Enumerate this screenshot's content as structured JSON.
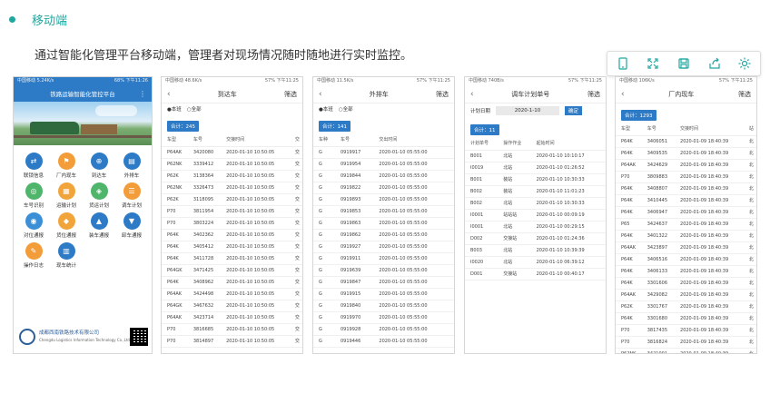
{
  "heading": "移动端",
  "intro": "通过智能化管理平台移动端，管理者对现场情况随时随地进行实时监控。",
  "accent": "#1fa7a0",
  "brand": "#2d7bc6",
  "toolbar": [
    "tablet-icon",
    "fullscreen-icon",
    "save-icon",
    "share-icon",
    "settings-icon"
  ],
  "phone1": {
    "status_left": "中国移动 5.24K/s",
    "status_right": "68% 下午11:26",
    "title": "铁路运输智能化管控平台",
    "menu": [
      {
        "label": "联锁信息",
        "color": "#2d7bc6",
        "glyph": "⇄"
      },
      {
        "label": "厂内现车",
        "color": "#f39c3a",
        "glyph": "⚑"
      },
      {
        "label": "到达车",
        "color": "#2d7bc6",
        "glyph": "⊕"
      },
      {
        "label": "外排车",
        "color": "#2d7bc6",
        "glyph": "▤"
      },
      {
        "label": "车号识别",
        "color": "#4fb56b",
        "glyph": "◎"
      },
      {
        "label": "运输计划",
        "color": "#f0a43a",
        "glyph": "▦"
      },
      {
        "label": "货运计划",
        "color": "#4fb56b",
        "glyph": "◈"
      },
      {
        "label": "调车计划",
        "color": "#f39c3a",
        "glyph": "☰"
      },
      {
        "label": "对位通报",
        "color": "#3b8fd6",
        "glyph": "◉"
      },
      {
        "label": "货位通报",
        "color": "#f0a43a",
        "glyph": "◆"
      },
      {
        "label": "装车通报",
        "color": "#2d7bc6",
        "glyph": "▲"
      },
      {
        "label": "卸车通报",
        "color": "#2d7bc6",
        "glyph": "▼"
      },
      {
        "label": "操作日志",
        "color": "#f39c3a",
        "glyph": "✎"
      },
      {
        "label": "现车统计",
        "color": "#2d7bc6",
        "glyph": "▥"
      }
    ],
    "company": "成都西南铁路技术有限公司",
    "company_en": "Chengdu Logistics Information Technology Co.,Ltd"
  },
  "arrivals": {
    "status_left": "中国移动 48.6K/s",
    "status_right": "57% 下午11:25",
    "title": "到达车",
    "action": "筛选",
    "filter": [
      "●本班",
      "○全部"
    ],
    "count": "合计：245",
    "headers": [
      "车型",
      "车号",
      "交接时间",
      "交"
    ],
    "rows": [
      [
        "P64AK",
        "3420080",
        "2020-01-10 10:50:05",
        "交"
      ],
      [
        "P62NK",
        "3339412",
        "2020-01-10 10:50:05",
        "交"
      ],
      [
        "P62K",
        "3138364",
        "2020-01-10 10:50:05",
        "交"
      ],
      [
        "P62NK",
        "3326473",
        "2020-01-10 10:50:05",
        "交"
      ],
      [
        "P62K",
        "3118095",
        "2020-01-10 10:50:05",
        "交"
      ],
      [
        "P70",
        "3811954",
        "2020-01-10 10:50:05",
        "交"
      ],
      [
        "P70",
        "3803224",
        "2020-01-10 10:50:05",
        "交"
      ],
      [
        "P64K",
        "3402362",
        "2020-01-10 10:50:05",
        "交"
      ],
      [
        "P64K",
        "3405412",
        "2020-01-10 10:50:05",
        "交"
      ],
      [
        "P64K",
        "3411728",
        "2020-01-10 10:50:05",
        "交"
      ],
      [
        "P64GK",
        "3471425",
        "2020-01-10 10:50:05",
        "交"
      ],
      [
        "P64K",
        "3408962",
        "2020-01-10 10:50:05",
        "交"
      ],
      [
        "P64AK",
        "3424498",
        "2020-01-10 10:50:05",
        "交"
      ],
      [
        "P64GK",
        "3467632",
        "2020-01-10 10:50:05",
        "交"
      ],
      [
        "P64AK",
        "3423714",
        "2020-01-10 10:50:05",
        "交"
      ],
      [
        "P70",
        "3816685",
        "2020-01-10 10:50:05",
        "交"
      ],
      [
        "P70",
        "3814897",
        "2020-01-10 10:50:05",
        "交"
      ]
    ]
  },
  "outbound": {
    "status_left": "中国移动 11.5K/s",
    "status_right": "57% 下午11:25",
    "title": "外排车",
    "action": "筛选",
    "filter": [
      "●本班",
      "○全部"
    ],
    "count": "合计：141",
    "headers": [
      "车种",
      "车号",
      "交出时间"
    ],
    "rows": [
      [
        "G",
        "0919917",
        "2020-01-10 05:55:00"
      ],
      [
        "G",
        "0919954",
        "2020-01-10 05:55:00"
      ],
      [
        "G",
        "0919844",
        "2020-01-10 05:55:00"
      ],
      [
        "G",
        "0919822",
        "2020-01-10 05:55:00"
      ],
      [
        "G",
        "0919893",
        "2020-01-10 05:55:00"
      ],
      [
        "G",
        "0919853",
        "2020-01-10 05:55:00"
      ],
      [
        "G",
        "0919863",
        "2020-01-10 05:55:00"
      ],
      [
        "G",
        "0919862",
        "2020-01-10 05:55:00"
      ],
      [
        "G",
        "0919927",
        "2020-01-10 05:55:00"
      ],
      [
        "G",
        "0919911",
        "2020-01-10 05:55:00"
      ],
      [
        "G",
        "0919639",
        "2020-01-10 05:55:00"
      ],
      [
        "G",
        "0919847",
        "2020-01-10 05:55:00"
      ],
      [
        "G",
        "0919915",
        "2020-01-10 05:55:00"
      ],
      [
        "G",
        "0919840",
        "2020-01-10 05:55:00"
      ],
      [
        "G",
        "0919970",
        "2020-01-10 05:55:00"
      ],
      [
        "G",
        "0919928",
        "2020-01-10 05:55:00"
      ],
      [
        "G",
        "0919446",
        "2020-01-10 05:55:00"
      ]
    ]
  },
  "shunting": {
    "status_left": "中国移动 740B/s",
    "status_right": "57% 下午11:25",
    "title": "调车计划单号",
    "action": "筛选",
    "date_label": "计划日期",
    "date_value": "2020-1-10",
    "ok_label": "确定",
    "count": "合计：11",
    "headers": [
      "计划单号",
      "操作作业",
      "起始时间"
    ],
    "rows": [
      [
        "B001",
        "北站",
        "2020-01-10 10:10:17"
      ],
      [
        "I0019",
        "北站",
        "2020-01-10 01:26:52"
      ],
      [
        "B001",
        "装站",
        "2020-01-10 10:30:33"
      ],
      [
        "B002",
        "装站",
        "2020-01-10 11:01:23"
      ],
      [
        "B002",
        "北站",
        "2020-01-10 10:30:33"
      ],
      [
        "I0001",
        "站站站",
        "2020-01-10 00:09:19"
      ],
      [
        "I0001",
        "北站",
        "2020-01-10 00:29:15"
      ],
      [
        "D002",
        "交接站",
        "2020-01-10 01:24:36"
      ],
      [
        "B003",
        "北站",
        "2020-01-10 10:39:39"
      ],
      [
        "I0020",
        "北站",
        "2020-01-10 06:39:12"
      ],
      [
        "D001",
        "交接站",
        "2020-01-10 00:40:17"
      ]
    ]
  },
  "yardcars": {
    "status_left": "中国移动 106K/s",
    "status_right": "57% 下午11:25",
    "title": "厂内现车",
    "action": "筛选",
    "count": "合计：1293",
    "headers": [
      "车型",
      "车号",
      "交接时间",
      "站"
    ],
    "rows": [
      [
        "P64K",
        "3406051",
        "2020-01-09 18:40:39",
        "北"
      ],
      [
        "P64K",
        "3409535",
        "2020-01-09 18:40:39",
        "北"
      ],
      [
        "P64AK",
        "3424629",
        "2020-01-09 18:40:39",
        "北"
      ],
      [
        "P70",
        "3809883",
        "2020-01-09 18:40:39",
        "北"
      ],
      [
        "P64K",
        "3408807",
        "2020-01-09 18:40:39",
        "北"
      ],
      [
        "P64K",
        "3410445",
        "2020-01-09 18:40:39",
        "北"
      ],
      [
        "P64K",
        "3406947",
        "2020-01-09 18:40:39",
        "北"
      ],
      [
        "P65",
        "3424637",
        "2020-01-09 18:40:39",
        "北"
      ],
      [
        "P64K",
        "3401322",
        "2020-01-09 18:40:39",
        "北"
      ],
      [
        "P64AK",
        "3423897",
        "2020-01-09 18:40:39",
        "北"
      ],
      [
        "P64K",
        "3406516",
        "2020-01-09 18:40:39",
        "北"
      ],
      [
        "P64K",
        "3406133",
        "2020-01-09 18:40:39",
        "北"
      ],
      [
        "P64K",
        "3301606",
        "2020-01-09 18:40:39",
        "北"
      ],
      [
        "P64AK",
        "3429082",
        "2020-01-09 18:40:39",
        "北"
      ],
      [
        "P62K",
        "3301767",
        "2020-01-09 18:40:39",
        "北"
      ],
      [
        "P64K",
        "3301680",
        "2020-01-09 18:40:39",
        "北"
      ],
      [
        "P70",
        "3817435",
        "2020-01-09 18:40:39",
        "北"
      ],
      [
        "P70",
        "3816824",
        "2020-01-09 18:40:39",
        "北"
      ],
      [
        "P62NK",
        "3421001",
        "2020-01-09 18:40:39",
        "北"
      ]
    ]
  }
}
